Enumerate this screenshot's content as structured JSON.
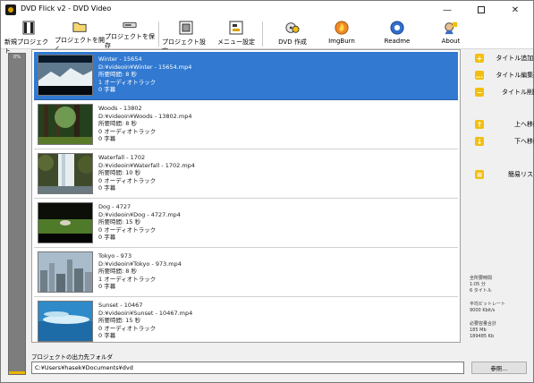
{
  "window": {
    "title": "DVD Flick v2 - DVD Video",
    "controls": {
      "minimize": "—",
      "close": "✕"
    }
  },
  "toolbar": [
    {
      "label": "新規プロジェクト",
      "icon": "new-project-icon"
    },
    {
      "label": "プロジェクトを開く",
      "icon": "open-folder-icon"
    },
    {
      "label": "プロジェクトを保存",
      "icon": "save-drive-icon"
    },
    {
      "label": "プロジェクト設定",
      "icon": "project-settings-icon"
    },
    {
      "label": "メニュー設定",
      "icon": "menu-settings-icon"
    },
    {
      "label": "DVD 作成",
      "icon": "create-dvd-icon"
    },
    {
      "label": "ImgBurn",
      "icon": "imgburn-icon"
    },
    {
      "label": "Readme",
      "icon": "readme-icon"
    },
    {
      "label": "About",
      "icon": "about-icon"
    }
  ],
  "progress": {
    "percent_label": "0%",
    "fill_fraction": 0.0
  },
  "titles": [
    {
      "name": "Winter - 15654",
      "path": "D:¥videoin¥Winter - 15654.mp4",
      "duration": "所要時間: 8 秒",
      "audio": "1 オーディオトラック",
      "subs": "0 字幕",
      "selected": true
    },
    {
      "name": "Woods - 13802",
      "path": "D:¥videoin¥Woods - 13802.mp4",
      "duration": "所要時間: 8 秒",
      "audio": "0 オーディオトラック",
      "subs": "0 字幕",
      "selected": false
    },
    {
      "name": "Waterfall - 1702",
      "path": "D:¥videoin¥Waterfall - 1702.mp4",
      "duration": "所要時間: 10 秒",
      "audio": "0 オーディオトラック",
      "subs": "0 字幕",
      "selected": false
    },
    {
      "name": "Dog - 4727",
      "path": "D:¥videoin¥Dog - 4727.mp4",
      "duration": "所要時間: 15 秒",
      "audio": "0 オーディオトラック",
      "subs": "0 字幕",
      "selected": false
    },
    {
      "name": "Tokyo - 973",
      "path": "D:¥videoin¥Tokyo - 973.mp4",
      "duration": "所要時間: 8 秒",
      "audio": "1 オーディオトラック",
      "subs": "0 字幕",
      "selected": false
    },
    {
      "name": "Sunset - 10467",
      "path": "D:¥videoin¥Sunset - 10467.mp4",
      "duration": "所要時間: 15 秒",
      "audio": "0 オーディオトラック",
      "subs": "0 字幕",
      "selected": false
    }
  ],
  "actions": {
    "add_title": "タイトル追加...",
    "edit_title": "タイトル編集...",
    "remove_title": "タイトル削除",
    "move_up": "上へ移動",
    "move_down": "下へ移動",
    "simple_list": "簡易リスト"
  },
  "stats": {
    "total_time_label": "全所要時間",
    "total_time_value": "1:05 分",
    "title_count": "6 タイトル",
    "avg_bitrate_label": "平均ビットレート",
    "avg_bitrate_value": "9000 Kbit/s",
    "required_size_label": "必要容量合計",
    "required_size_mb": "185 Mb",
    "required_size_kb": "189485 Kb"
  },
  "output": {
    "label": "プロジェクトの出力先フォルダ",
    "path": "C:¥Users¥hasek¥Documents¥dvd",
    "browse_label": "参照..."
  },
  "colors": {
    "selection": "#3179d1",
    "action_icon": "#f2be10",
    "progress_fill": "#e8b400"
  }
}
